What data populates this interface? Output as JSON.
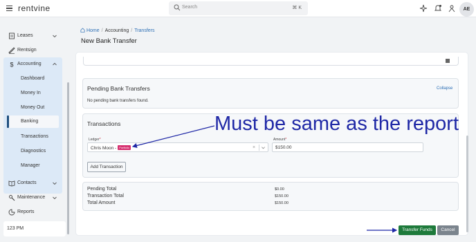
{
  "app": {
    "brand": "Rentvine",
    "logo_text": "rentvine"
  },
  "search": {
    "placeholder": "Search",
    "shortcut": "⌘ K"
  },
  "user": {
    "initials": "AE"
  },
  "sidebar": {
    "items": [
      {
        "label": "Leases",
        "icon": "leases-icon"
      },
      {
        "label": "Rentsign",
        "icon": "rentsign-icon"
      },
      {
        "label": "Accounting",
        "icon": "dollar-icon"
      },
      {
        "label": "Contacts",
        "icon": "contacts-icon"
      },
      {
        "label": "Maintenance",
        "icon": "wrench-icon"
      },
      {
        "label": "Reports",
        "icon": "reports-icon"
      }
    ],
    "accounting_sub": [
      "Dashboard",
      "Money In",
      "Money Out",
      "Banking",
      "Transactions",
      "Diagnostics",
      "Manager"
    ],
    "active_sub": "Banking",
    "time": "123 PM"
  },
  "breadcrumb": {
    "home": "Home",
    "section": "Accounting",
    "current": "Transfers"
  },
  "page": {
    "title": "New Bank Transfer"
  },
  "pending": {
    "title": "Pending Bank Transfers",
    "collapse": "Collapse",
    "empty": "No pending bank transfers found."
  },
  "transactions": {
    "title": "Transactions",
    "ledger_label": "Ledger",
    "ledger_value": "Chris Moon -",
    "ledger_badge": "Portfolio",
    "amount_label": "Amount",
    "amount_value": "$150.00",
    "add_button": "Add Transaction"
  },
  "totals": [
    {
      "label": "Pending Total",
      "value": "$0.00"
    },
    {
      "label": "Transaction Total",
      "value": "$150.00"
    },
    {
      "label": "Total Amount",
      "value": "$150.00"
    }
  ],
  "actions": {
    "submit": "Transfer Funds",
    "cancel": "Cancel"
  },
  "annotation": {
    "text": "Must be same as the report",
    "color": "#1f28a6"
  },
  "colors": {
    "primary": "#1e7a3b",
    "link": "#2d6fb5",
    "badge": "#d62f6f",
    "sidebar_active_bg": "#dce9f7"
  }
}
